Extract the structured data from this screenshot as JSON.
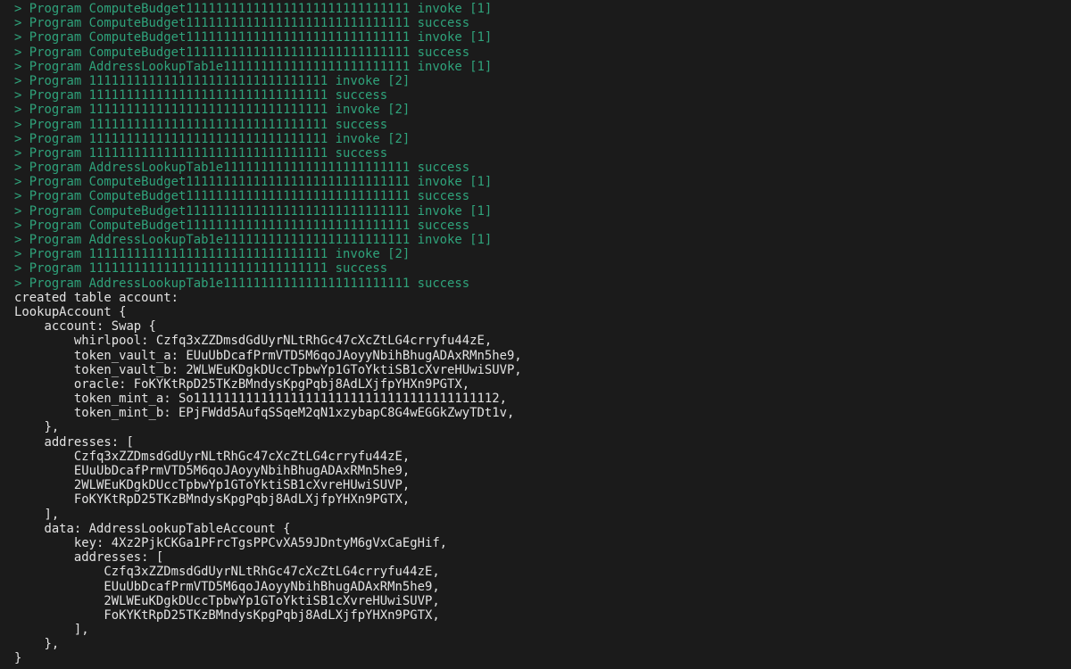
{
  "terminal": {
    "colors": {
      "background": "#1b1b1b",
      "log_text": "#2fa37b",
      "output_text": "#e2e2e2"
    },
    "log_lines": [
      "> Program ComputeBudget111111111111111111111111111111 invoke [1]",
      "> Program ComputeBudget111111111111111111111111111111 success",
      "> Program ComputeBudget111111111111111111111111111111 invoke [1]",
      "> Program ComputeBudget111111111111111111111111111111 success",
      "> Program AddressLookupTab1e1111111111111111111111111 invoke [1]",
      "> Program 11111111111111111111111111111111 invoke [2]",
      "> Program 11111111111111111111111111111111 success",
      "> Program 11111111111111111111111111111111 invoke [2]",
      "> Program 11111111111111111111111111111111 success",
      "> Program 11111111111111111111111111111111 invoke [2]",
      "> Program 11111111111111111111111111111111 success",
      "> Program AddressLookupTab1e1111111111111111111111111 success",
      "> Program ComputeBudget111111111111111111111111111111 invoke [1]",
      "> Program ComputeBudget111111111111111111111111111111 success",
      "> Program ComputeBudget111111111111111111111111111111 invoke [1]",
      "> Program ComputeBudget111111111111111111111111111111 success",
      "> Program AddressLookupTab1e1111111111111111111111111 invoke [1]",
      "> Program 11111111111111111111111111111111 invoke [2]",
      "> Program 11111111111111111111111111111111 success",
      "> Program AddressLookupTab1e1111111111111111111111111 success"
    ],
    "output_lines": [
      "created table account:",
      "LookupAccount {",
      "    account: Swap {",
      "        whirlpool: Czfq3xZZDmsdGdUyrNLtRhGc47cXcZtLG4crryfu44zE,",
      "        token_vault_a: EUuUbDcafPrmVTD5M6qoJAoyyNbihBhugADAxRMn5he9,",
      "        token_vault_b: 2WLWEuKDgkDUccTpbwYp1GToYktiSB1cXvreHUwiSUVP,",
      "        oracle: FoKYKtRpD25TKzBMndysKpgPqbj8AdLXjfpYHXn9PGTX,",
      "        token_mint_a: So11111111111111111111111111111111111111112,",
      "        token_mint_b: EPjFWdd5AufqSSqeM2qN1xzybapC8G4wEGGkZwyTDt1v,",
      "    },",
      "    addresses: [",
      "        Czfq3xZZDmsdGdUyrNLtRhGc47cXcZtLG4crryfu44zE,",
      "        EUuUbDcafPrmVTD5M6qoJAoyyNbihBhugADAxRMn5he9,",
      "        2WLWEuKDgkDUccTpbwYp1GToYktiSB1cXvreHUwiSUVP,",
      "        FoKYKtRpD25TKzBMndysKpgPqbj8AdLXjfpYHXn9PGTX,",
      "    ],",
      "    data: AddressLookupTableAccount {",
      "        key: 4Xz2PjkCKGa1PFrcTgsPPCvXA59JDntyM6gVxCaEgHif,",
      "        addresses: [",
      "            Czfq3xZZDmsdGdUyrNLtRhGc47cXcZtLG4crryfu44zE,",
      "            EUuUbDcafPrmVTD5M6qoJAoyyNbihBhugADAxRMn5he9,",
      "            2WLWEuKDgkDUccTpbwYp1GToYktiSB1cXvreHUwiSUVP,",
      "            FoKYKtRpD25TKzBMndysKpgPqbj8AdLXjfpYHXn9PGTX,",
      "        ],",
      "    },",
      "}"
    ]
  }
}
